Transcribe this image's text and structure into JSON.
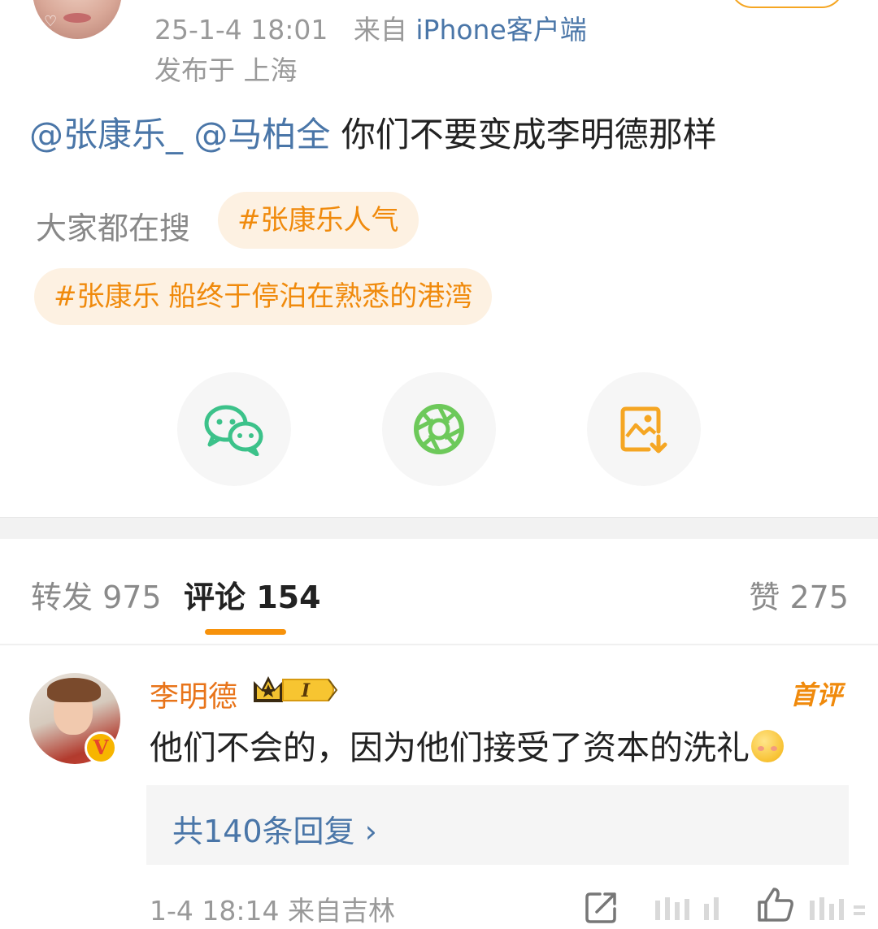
{
  "post": {
    "time": "25-1-4 18:01",
    "source_prefix": "来自",
    "source": "iPhone客户端",
    "location": "发布于 上海",
    "mention1": "@张康乐_",
    "mention2": "@马柏全",
    "text": "你们不要变成李明德那样"
  },
  "search": {
    "label": "大家都在搜",
    "tags": [
      "#张康乐人气",
      "#张康乐 船终于停泊在熟悉的港湾"
    ]
  },
  "share": {
    "icons": [
      "wechat-icon",
      "moments-icon",
      "save-image-icon"
    ]
  },
  "tabs": {
    "repost": "转发 975",
    "comment": "评论 154",
    "like": "赞 275"
  },
  "comment": {
    "author": "李明德",
    "level_badge": "I",
    "verified_mark": "V",
    "first_label": "首评",
    "text": "他们不会的，因为他们接受了资本的洗礼",
    "replies": "共140条回复 ›",
    "time": "1-4 18:14",
    "location": "来自吉林"
  },
  "colors": {
    "mention": "#4a76a8",
    "tag_text": "#f08a0c",
    "tag_bg": "#fdf1e2",
    "accent": "#f7920b",
    "author": "#e8741a"
  }
}
